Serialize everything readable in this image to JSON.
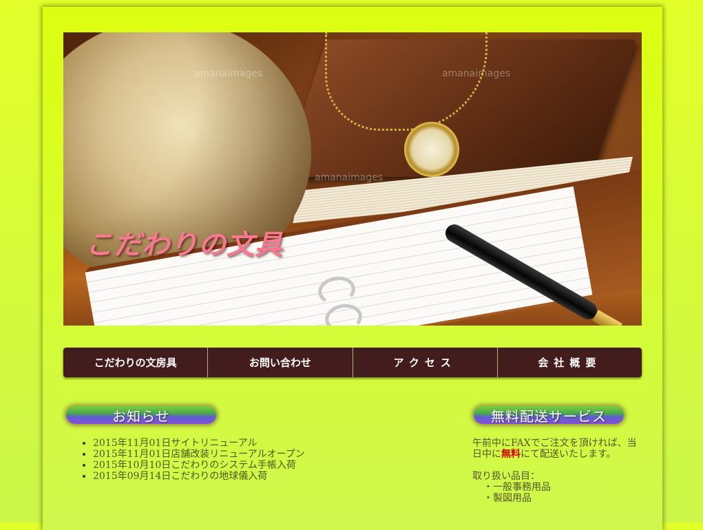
{
  "header": {
    "site_title": "こだわりの文具",
    "watermark": "amanaimages"
  },
  "nav": {
    "items": [
      "こだわりの文房具",
      "お問い合わせ",
      "アクセス",
      "会社概要"
    ]
  },
  "news": {
    "heading": "お知らせ",
    "items": [
      "2015年11月01日サイトリニューアル",
      "2015年11月01日店舗改装リニューアルオープン",
      "2015年10月10日こだわりのシステム手帳入荷",
      "2015年09月14日こだわりの地球儀入荷"
    ]
  },
  "service": {
    "heading": "無料配送サービス",
    "text_before": "午前中にFAXでご注文を頂ければ、当日中に",
    "text_highlight": "無料",
    "text_after": "にて配送いたします。",
    "items_label": "取り扱い品目：",
    "items": [
      "・一般事務用品",
      "・製図用品"
    ]
  },
  "colors": {
    "background": "#dcff10",
    "nav_background": "#431c1e",
    "title_pink": "#f5798f",
    "highlight_red": "#d40000"
  }
}
